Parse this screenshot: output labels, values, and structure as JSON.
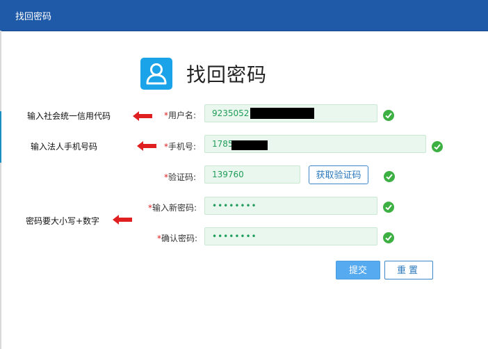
{
  "window": {
    "title": "找回密码"
  },
  "header": {
    "title": "找回密码",
    "icon": "user-icon",
    "icon_color": "#1aa3e8"
  },
  "annotations": {
    "username_hint": "输入社会统一信用代码",
    "phone_hint": "输入法人手机号码",
    "password_hint": "密码要大小写+数字",
    "arrow_color": "#e02020"
  },
  "form": {
    "required_mark": "*",
    "username": {
      "label": "用户名:",
      "value": "92350521"
    },
    "phone": {
      "label": "手机号:",
      "value": "1785"
    },
    "code": {
      "label": "验证码:",
      "value": "139760",
      "button": "获取验证码"
    },
    "new_password": {
      "label": "输入新密码:",
      "value": "••••••••"
    },
    "confirm_password": {
      "label": "确认密码:",
      "value": "••••••••"
    },
    "valid_icon": "check-circle-icon",
    "valid_color": "#3db043"
  },
  "actions": {
    "submit": "提交",
    "reset": "重置"
  },
  "colors": {
    "titlebar": "#1e5aa8",
    "input_bg": "#eaf7ee",
    "input_text": "#1f9d5a",
    "primary_button": "#55aaf0"
  }
}
